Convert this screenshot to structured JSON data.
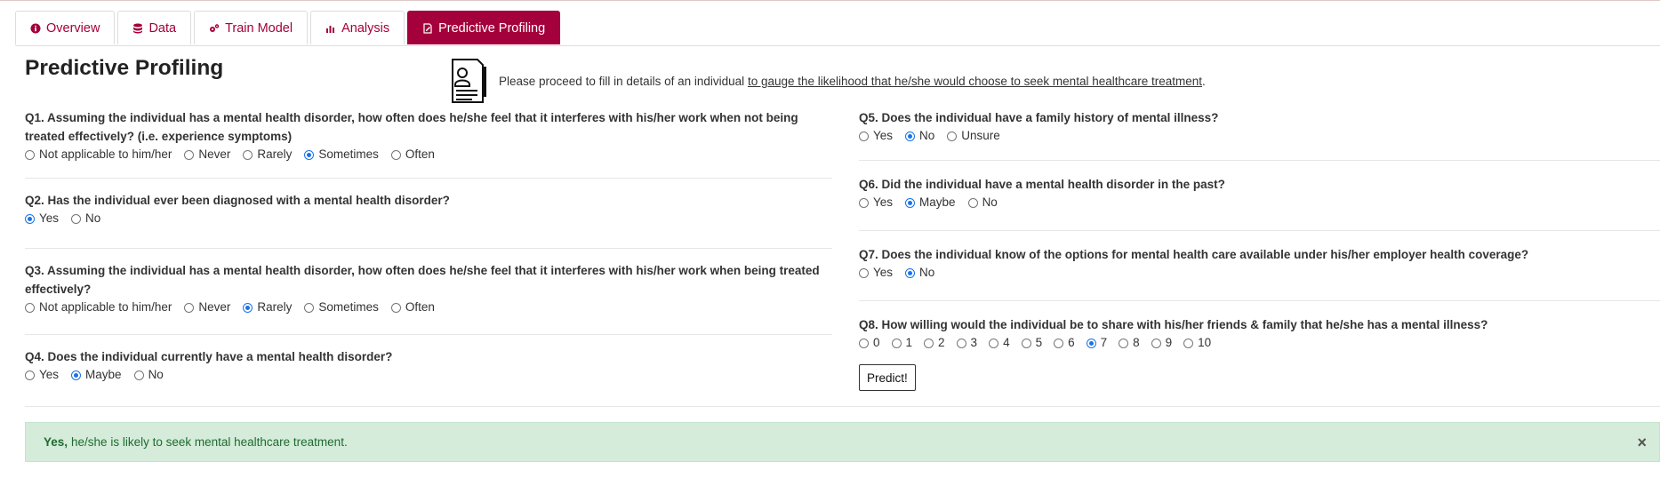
{
  "tabs": [
    {
      "label": "Overview",
      "icon": "info-circle-icon",
      "active": false
    },
    {
      "label": "Data",
      "icon": "database-icon",
      "active": false
    },
    {
      "label": "Train Model",
      "icon": "gears-icon",
      "active": false
    },
    {
      "label": "Analysis",
      "icon": "bar-chart-icon",
      "active": false
    },
    {
      "label": "Predictive Profiling",
      "icon": "edit-document-icon",
      "active": true
    }
  ],
  "page": {
    "title": "Predictive Profiling",
    "intro_text": "Please proceed to fill in details of an individual",
    "intro_link": "to gauge the likelihood that he/she would choose to seek mental healthcare treatment",
    "intro_end": "."
  },
  "questions_left": [
    {
      "id": "Q1",
      "text": "Q1. Assuming the individual has a mental health disorder, how often does he/she feel that it interferes with his/her work when not being treated effectively? (i.e. experience symptoms)",
      "options": [
        "Not applicable to him/her",
        "Never",
        "Rarely",
        "Sometimes",
        "Often"
      ],
      "selected": "Sometimes"
    },
    {
      "id": "Q2",
      "text": "Q2. Has the individual ever been diagnosed with a mental health disorder?",
      "options": [
        "Yes",
        "No"
      ],
      "selected": "Yes"
    },
    {
      "id": "Q3",
      "text": "Q3. Assuming the individual has a mental health disorder, how often does he/she feel that it interferes with his/her work when being treated effectively?",
      "options": [
        "Not applicable to him/her",
        "Never",
        "Rarely",
        "Sometimes",
        "Often"
      ],
      "selected": "Rarely"
    },
    {
      "id": "Q4",
      "text": "Q4. Does the individual currently have a mental health disorder?",
      "options": [
        "Yes",
        "Maybe",
        "No"
      ],
      "selected": "Maybe"
    }
  ],
  "questions_right": [
    {
      "id": "Q5",
      "text": "Q5. Does the individual have a family history of mental illness?",
      "options": [
        "Yes",
        "No",
        "Unsure"
      ],
      "selected": "No"
    },
    {
      "id": "Q6",
      "text": "Q6. Did the individual have a mental health disorder in the past?",
      "options": [
        "Yes",
        "Maybe",
        "No"
      ],
      "selected": "Maybe"
    },
    {
      "id": "Q7",
      "text": "Q7. Does the individual know of the options for mental health care available under his/her employer health coverage?",
      "options": [
        "Yes",
        "No"
      ],
      "selected": "No"
    },
    {
      "id": "Q8",
      "text": "Q8. How willing would the individual be to share with his/her friends & family that he/she has a mental illness?",
      "options": [
        "0",
        "1",
        "2",
        "3",
        "4",
        "5",
        "6",
        "7",
        "8",
        "9",
        "10"
      ],
      "selected": "7"
    }
  ],
  "predict_button": "Predict!",
  "result": {
    "bold": "Yes,",
    "text": "he/she is likely to seek mental healthcare treatment.",
    "close": "×"
  },
  "colors": {
    "brand": "#a4003b",
    "success_bg": "#d4ecd9",
    "success_text": "#1f6b32",
    "radio_checked": "#1a73e8"
  }
}
